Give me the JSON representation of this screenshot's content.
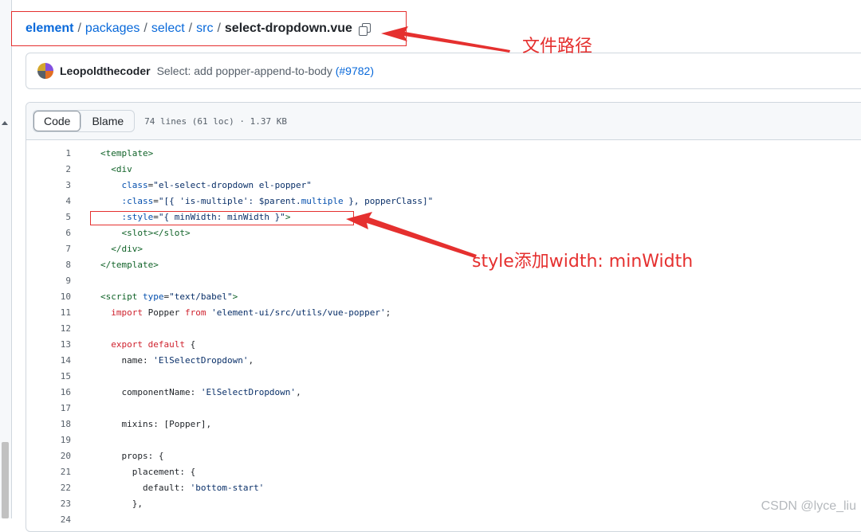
{
  "breadcrumb": {
    "items": [
      "element",
      "packages",
      "select",
      "src"
    ],
    "separator": "/",
    "file": "select-dropdown.vue"
  },
  "commit": {
    "author": "Leopoldthecoder",
    "message": "Select: add popper-append-to-body",
    "pr": "(#9782)"
  },
  "file_header": {
    "tabs": [
      "Code",
      "Blame"
    ],
    "active_tab": "Code",
    "info": "74 lines (61 loc) · 1.37 KB"
  },
  "code_lines": [
    {
      "n": "1",
      "tokens": [
        {
          "c": "t-tag",
          "t": "<template>"
        }
      ]
    },
    {
      "n": "2",
      "tokens": [
        {
          "c": "t-plain",
          "t": "  "
        },
        {
          "c": "t-tag",
          "t": "<div"
        }
      ]
    },
    {
      "n": "3",
      "tokens": [
        {
          "c": "t-plain",
          "t": "    "
        },
        {
          "c": "t-attr",
          "t": "class"
        },
        {
          "c": "t-plain",
          "t": "="
        },
        {
          "c": "t-str",
          "t": "\"el-select-dropdown el-popper\""
        }
      ]
    },
    {
      "n": "4",
      "tokens": [
        {
          "c": "t-plain",
          "t": "    "
        },
        {
          "c": "t-attr",
          "t": ":class"
        },
        {
          "c": "t-plain",
          "t": "="
        },
        {
          "c": "t-str",
          "t": "\"[{ 'is-multiple': $parent."
        },
        {
          "c": "t-prop",
          "t": "multiple"
        },
        {
          "c": "t-str",
          "t": " }, popperClass]\""
        }
      ]
    },
    {
      "n": "5",
      "tokens": [
        {
          "c": "t-plain",
          "t": "    "
        },
        {
          "c": "t-attr",
          "t": ":style"
        },
        {
          "c": "t-plain",
          "t": "="
        },
        {
          "c": "t-str",
          "t": "\"{ minWidth: minWidth }\""
        },
        {
          "c": "t-tag",
          "t": ">"
        }
      ]
    },
    {
      "n": "6",
      "tokens": [
        {
          "c": "t-plain",
          "t": "    "
        },
        {
          "c": "t-tag",
          "t": "<slot></slot>"
        }
      ]
    },
    {
      "n": "7",
      "tokens": [
        {
          "c": "t-plain",
          "t": "  "
        },
        {
          "c": "t-tag",
          "t": "</div>"
        }
      ]
    },
    {
      "n": "8",
      "tokens": [
        {
          "c": "t-tag",
          "t": "</template>"
        }
      ]
    },
    {
      "n": "9",
      "tokens": []
    },
    {
      "n": "10",
      "tokens": [
        {
          "c": "t-tag",
          "t": "<script"
        },
        {
          "c": "t-plain",
          "t": " "
        },
        {
          "c": "t-attr",
          "t": "type"
        },
        {
          "c": "t-plain",
          "t": "="
        },
        {
          "c": "t-str",
          "t": "\"text/babel\""
        },
        {
          "c": "t-tag",
          "t": ">"
        }
      ]
    },
    {
      "n": "11",
      "tokens": [
        {
          "c": "t-plain",
          "t": "  "
        },
        {
          "c": "t-kw",
          "t": "import"
        },
        {
          "c": "t-plain",
          "t": " Popper "
        },
        {
          "c": "t-kw",
          "t": "from"
        },
        {
          "c": "t-plain",
          "t": " "
        },
        {
          "c": "t-str",
          "t": "'element-ui/src/utils/vue-popper'"
        },
        {
          "c": "t-plain",
          "t": ";"
        }
      ]
    },
    {
      "n": "12",
      "tokens": []
    },
    {
      "n": "13",
      "tokens": [
        {
          "c": "t-plain",
          "t": "  "
        },
        {
          "c": "t-kw",
          "t": "export"
        },
        {
          "c": "t-plain",
          "t": " "
        },
        {
          "c": "t-kw",
          "t": "default"
        },
        {
          "c": "t-plain",
          "t": " {"
        }
      ]
    },
    {
      "n": "14",
      "tokens": [
        {
          "c": "t-plain",
          "t": "    name: "
        },
        {
          "c": "t-str",
          "t": "'ElSelectDropdown'"
        },
        {
          "c": "t-plain",
          "t": ","
        }
      ]
    },
    {
      "n": "15",
      "tokens": []
    },
    {
      "n": "16",
      "tokens": [
        {
          "c": "t-plain",
          "t": "    componentName: "
        },
        {
          "c": "t-str",
          "t": "'ElSelectDropdown'"
        },
        {
          "c": "t-plain",
          "t": ","
        }
      ]
    },
    {
      "n": "17",
      "tokens": []
    },
    {
      "n": "18",
      "tokens": [
        {
          "c": "t-plain",
          "t": "    mixins: [Popper],"
        }
      ]
    },
    {
      "n": "19",
      "tokens": []
    },
    {
      "n": "20",
      "tokens": [
        {
          "c": "t-plain",
          "t": "    props: {"
        }
      ]
    },
    {
      "n": "21",
      "tokens": [
        {
          "c": "t-plain",
          "t": "      placement: {"
        }
      ]
    },
    {
      "n": "22",
      "tokens": [
        {
          "c": "t-plain",
          "t": "        default: "
        },
        {
          "c": "t-str",
          "t": "'bottom-start'"
        }
      ]
    },
    {
      "n": "23",
      "tokens": [
        {
          "c": "t-plain",
          "t": "      },"
        }
      ]
    },
    {
      "n": "24",
      "tokens": []
    }
  ],
  "annotations": {
    "path_label": "文件路径",
    "style_label": "style添加width: minWidth",
    "color": "#e5302f"
  },
  "watermark": "CSDN @lyce_liu"
}
